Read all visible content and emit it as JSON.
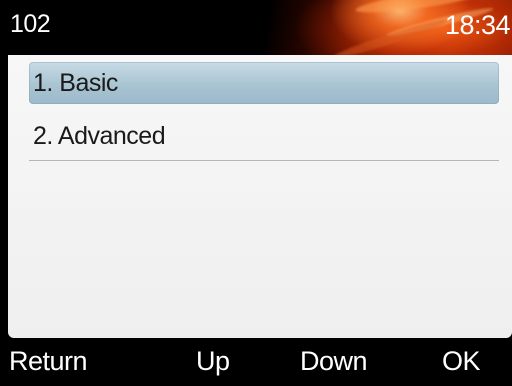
{
  "status_bar": {
    "account": "102",
    "time": "18:34"
  },
  "menu": {
    "items": [
      {
        "label": "1. Basic",
        "selected": true
      },
      {
        "label": "2. Advanced",
        "selected": false
      }
    ]
  },
  "softkeys": {
    "return": "Return",
    "up": "Up",
    "down": "Down",
    "ok": "OK"
  },
  "colors": {
    "selection": "#a9c4d2",
    "background": "#efefef",
    "bars": "#000000",
    "flame": "#c83c0a"
  }
}
